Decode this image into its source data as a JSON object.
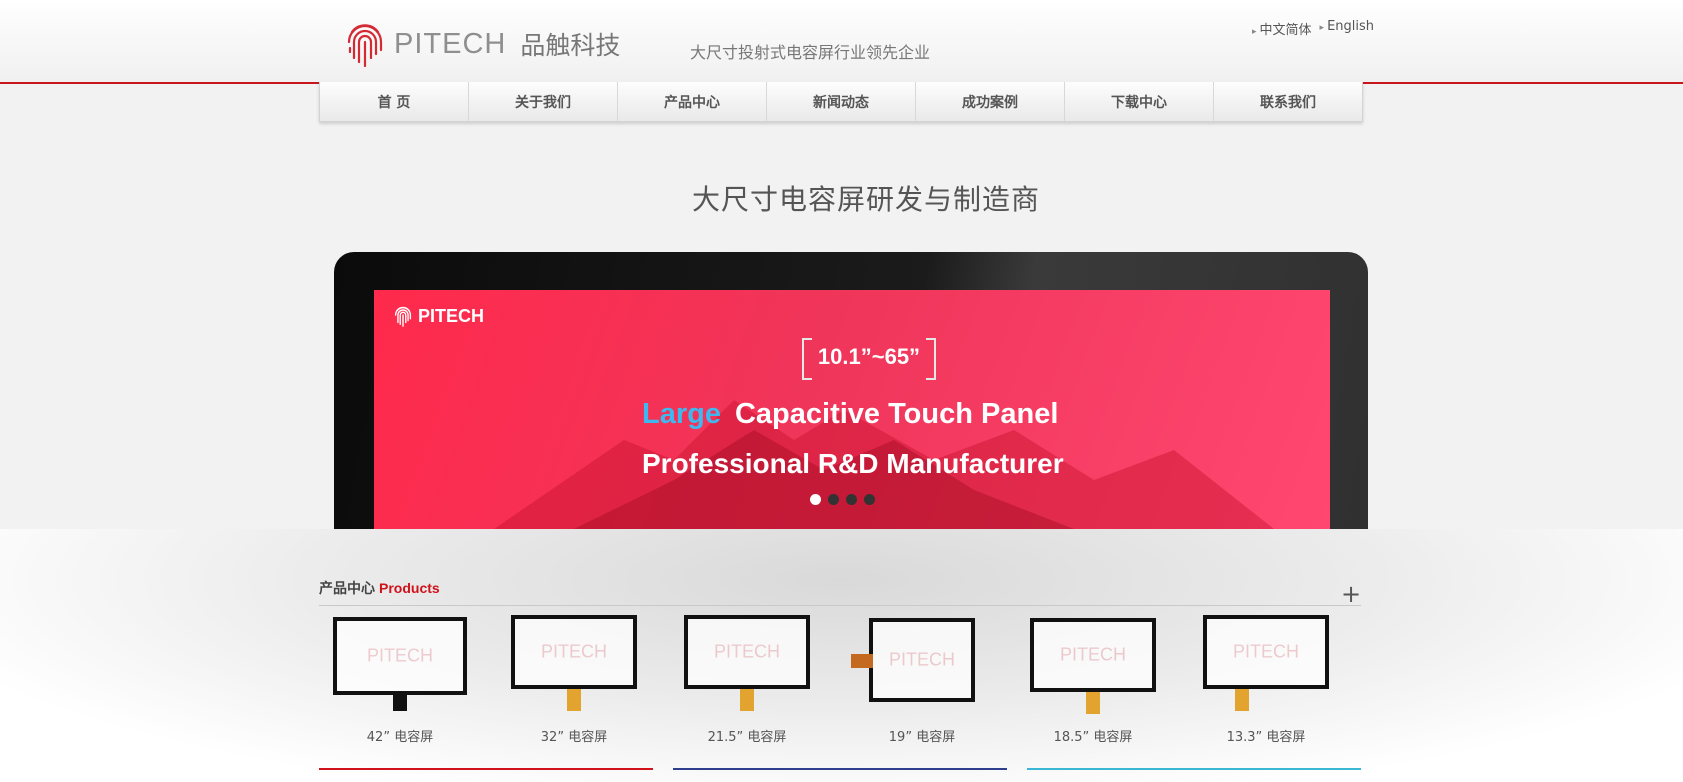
{
  "header": {
    "logo_en": "PITECH",
    "logo_cn": "品触科技",
    "slogan": "大尺寸投射式电容屏行业领先企业",
    "languages": [
      "中文简体",
      "English"
    ]
  },
  "nav": {
    "items": [
      "首 页",
      "关于我们",
      "产品中心",
      "新闻动态",
      "成功案例",
      "下载中心",
      "联系我们"
    ]
  },
  "hero": {
    "title": "大尺寸电容屏研发与制造商",
    "banner_logo": "PITECH",
    "size_range": "10.1”~65”",
    "line1_highlight": "Large",
    "line1_rest": "Capacitive Touch Panel",
    "line2": "Professional R&D Manufacturer",
    "slide_count": 4,
    "active_slide": 1
  },
  "products": {
    "title_cn": "产品中心",
    "title_en": "Products",
    "more_label": "+",
    "watermark": "PITECH",
    "items": [
      {
        "name": "42” 电容屏"
      },
      {
        "name": "32” 电容屏"
      },
      {
        "name": "21.5” 电容屏"
      },
      {
        "name": "19” 电容屏"
      },
      {
        "name": "18.5” 电容屏"
      },
      {
        "name": "13.3” 电容屏"
      }
    ]
  },
  "colors": {
    "brand_red": "#c8161d",
    "banner_pink": "#ff2a4c",
    "highlight_blue": "#3fb8f0",
    "bar_red": "#d0121b",
    "bar_blue": "#2e3f8f",
    "bar_cyan": "#39b8d6"
  }
}
